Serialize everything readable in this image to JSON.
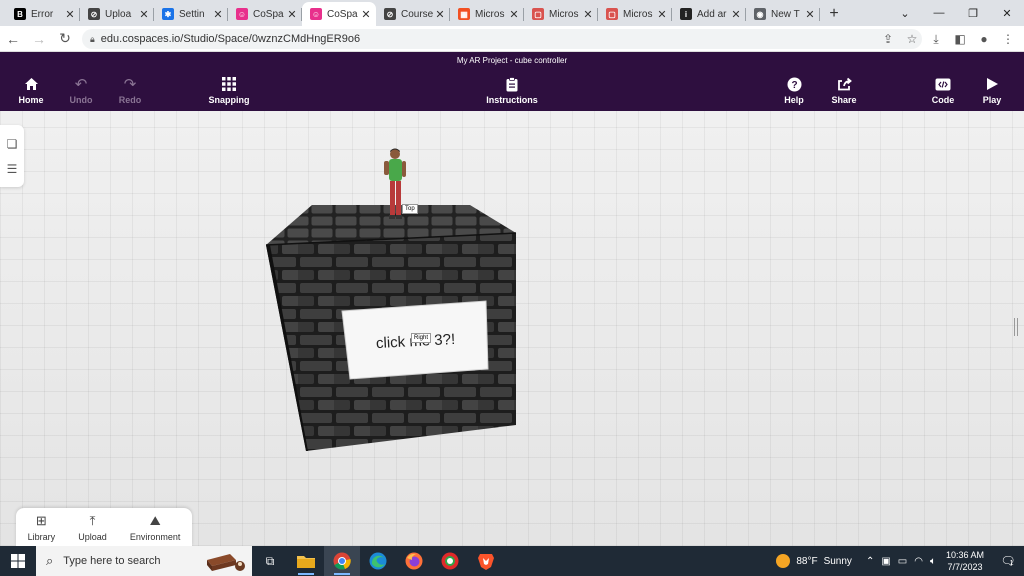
{
  "browser": {
    "tabs": [
      {
        "label": "Error",
        "icon": "b-icon",
        "color": "#000000",
        "glyph": "B",
        "active": false
      },
      {
        "label": "Uploa",
        "icon": "compass-icon",
        "color": "#444444",
        "glyph": "⊘",
        "active": false
      },
      {
        "label": "Settin",
        "icon": "gear-icon",
        "color": "#1a73e8",
        "glyph": "✱",
        "active": false
      },
      {
        "label": "CoSpa",
        "icon": "cospaces-icon",
        "color": "#e8308c",
        "glyph": "☺",
        "active": false
      },
      {
        "label": "CoSpa",
        "icon": "cospaces-icon",
        "color": "#e8308c",
        "glyph": "☺",
        "active": true
      },
      {
        "label": "Course",
        "icon": "compass-icon",
        "color": "#444444",
        "glyph": "⊘",
        "active": false
      },
      {
        "label": "Micros",
        "icon": "microsoft-icon",
        "color": "#f25022",
        "glyph": "▦",
        "active": false
      },
      {
        "label": "Micros",
        "icon": "forms-icon",
        "color": "#d9534f",
        "glyph": "▢",
        "active": false
      },
      {
        "label": "Micros",
        "icon": "forms-icon",
        "color": "#d9534f",
        "glyph": "▢",
        "active": false
      },
      {
        "label": "Add ar",
        "icon": "info-icon",
        "color": "#222222",
        "glyph": "i",
        "active": false
      },
      {
        "label": "New T",
        "icon": "chrome-icon",
        "color": "#5f6368",
        "glyph": "◉",
        "active": false
      }
    ],
    "close_glyph": "✕",
    "new_tab_glyph": "+",
    "url": "edu.cospaces.io/Studio/Space/0wznzCMdHngER9o6"
  },
  "app": {
    "title": "My AR Project - cube controller",
    "toolbar": {
      "home": "Home",
      "undo": "Undo",
      "redo": "Redo",
      "snapping": "Snapping",
      "instructions": "Instructions",
      "help": "Help",
      "share": "Share",
      "code": "Code",
      "play": "Play"
    }
  },
  "scene": {
    "top_label": "Top",
    "sign_text": "click me 3?!",
    "right_label": "Right"
  },
  "bottom_panel": {
    "library": "Library",
    "upload": "Upload",
    "environment": "Environment"
  },
  "taskbar": {
    "search_placeholder": "Type here to search",
    "weather_temp": "88°F",
    "weather_text": "Sunny",
    "time": "10:36 AM",
    "date": "7/7/2023",
    "notification_count": "1"
  }
}
